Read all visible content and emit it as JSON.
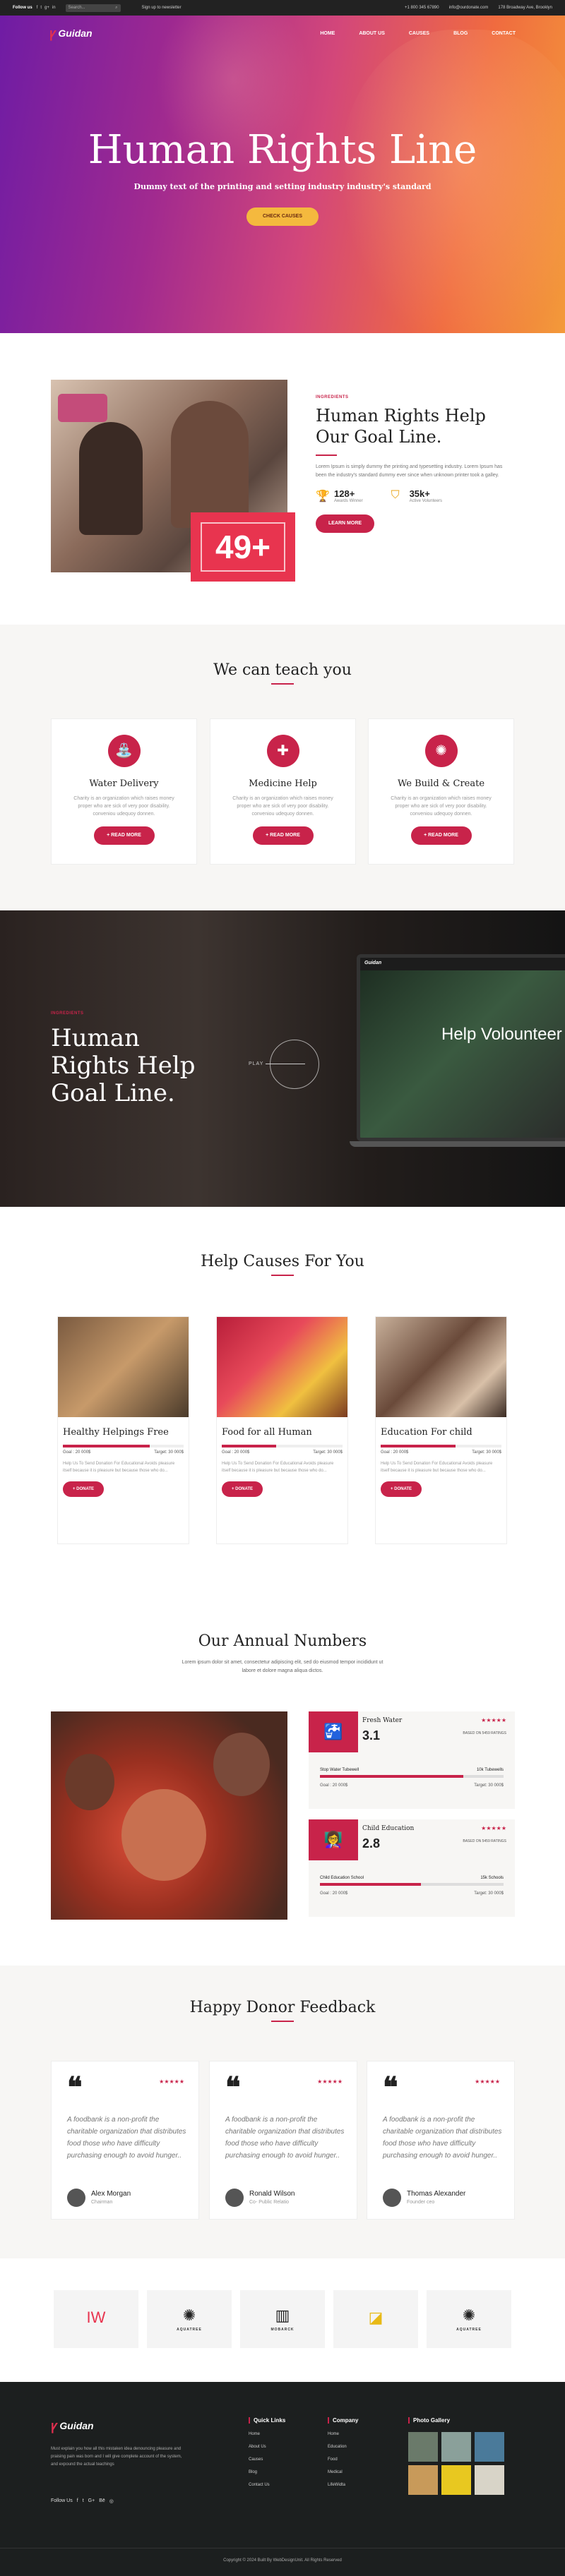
{
  "topbar": {
    "follow": "Follow us",
    "search_placeholder": "Search...",
    "signup": "Sign up to newsletter",
    "phone": "+1 800 345 67890",
    "email": "info@ourdonate.com",
    "address": "178 Broadway Ave, Brooklyn"
  },
  "nav": {
    "logo": "Guidan",
    "items": [
      "HOME",
      "ABOUT US",
      "CAUSES",
      "BLOG",
      "CONTACT"
    ]
  },
  "hero": {
    "title": "Human Rights Line",
    "subtitle": "Dummy text of the printing and setting industry industry's standard",
    "cta": "CHECK CAUSES"
  },
  "about": {
    "badge": "49+",
    "eyebrow": "INGREDIENTS",
    "title": "Human Rights Help Our Goal Line.",
    "text": "Lorem Ipsum is simply dummy the printing and typesetting industry. Lorem Ipsum has been the industry's standard dummy ever since when unknown printer took a galley.",
    "stats": [
      {
        "value": "128+",
        "label": "Awards Winner"
      },
      {
        "value": "35k+",
        "label": "Active Volunteers"
      }
    ],
    "button": "LEARN MORE"
  },
  "teach": {
    "title": "We can teach you",
    "cards": [
      {
        "title": "Water Delivery",
        "text": "Charity is an organization which raises money proper who are sick of very poor disability. conveniou udequoy donnen.",
        "button": "+ READ MORE"
      },
      {
        "title": "Medicine Help",
        "text": "Charity is an organization which raises money proper who are sick of very poor disability. conveniou udequoy donnen.",
        "button": "+ READ MORE"
      },
      {
        "title": "We Build & Create",
        "text": "Charity is an organization which raises money proper who are sick of very poor disability. conveniou udequoy donnen.",
        "button": "+ READ MORE"
      }
    ]
  },
  "band": {
    "eyebrow": "INGREDIENTS",
    "title": "Human Rights Help Goal Line.",
    "play": "PLAY",
    "screen_logo": "Guidan",
    "screen_title": "Help Volounteer"
  },
  "causes": {
    "title": "Help Causes For You",
    "items": [
      {
        "title": "Healthy Helpings Free",
        "progress": 0.72,
        "goal": "Goal : 20 000$",
        "target": "Target: 30 000$",
        "text": "Help Us To Send Donation For Educational Avoids pleasure itself because it is pleasure but because those who do...",
        "button": "+ DONATE"
      },
      {
        "title": "Food for all Human",
        "progress": 0.45,
        "goal": "Goal : 20 000$",
        "target": "Target: 30 000$",
        "text": "Help Us To Send Donation For Educational Avoids pleasure itself because it is pleasure but because those who do...",
        "button": "+ DONATE"
      },
      {
        "title": "Education For child",
        "progress": 0.62,
        "goal": "Goal : 20 000$",
        "target": "Target: 30 000$",
        "text": "Help Us To Send Donation For Educational Avoids pleasure itself because it is pleasure but because those who do...",
        "button": "+ DONATE"
      }
    ]
  },
  "numbers": {
    "title": "Our Annual Numbers",
    "text": "Lorem ipsum dolor sit amet, consectetur adipiscing elit, sed do eiusmod tempor incididunt ut labore et dolore magna aliqua dictos.",
    "cards": [
      {
        "name": "Fresh Water",
        "value": "3.1",
        "stars": "★★★★★",
        "basis": "BASED ON 5459 RATINGS",
        "row_label": "Stop Water Tubewell",
        "row_value": "10k Tubewells",
        "progress": 0.78,
        "goal": "Goal : 20 000$",
        "target": "Target: 30 000$"
      },
      {
        "name": "Child Education",
        "value": "2.8",
        "stars": "★★★★★",
        "basis": "BASED ON 5459 RATINGS",
        "row_label": "Child Education School",
        "row_value": "15k Schools",
        "progress": 0.55,
        "goal": "Goal : 20 000$",
        "target": "Target: 30 000$"
      }
    ]
  },
  "feedback": {
    "title": "Happy Donor Feedback",
    "items": [
      {
        "text": "A foodbank is a non-profit the charitable organization that distributes food those who have difficulty purchasing enough to avoid hunger..",
        "name": "Alex Morgan",
        "role": "Chairman",
        "stars": "★★★★★"
      },
      {
        "text": "A foodbank is a non-profit the charitable organization that distributes food those who have difficulty purchasing enough to avoid hunger..",
        "name": "Ronald Wilson",
        "role": "Co- Public Relatio",
        "stars": "★★★★★"
      },
      {
        "text": "A foodbank is a non-profit the charitable organization that distributes food those who have difficulty purchasing enough to avoid hunger..",
        "name": "Thomas Alexander",
        "role": "Founder ceo",
        "stars": "★★★★★"
      }
    ]
  },
  "sponsors": [
    {
      "glyph": "IW",
      "word": ""
    },
    {
      "glyph": "✺",
      "word": "AQUATREE"
    },
    {
      "glyph": "▥",
      "word": "MOBARCK"
    },
    {
      "glyph": "◪",
      "word": ""
    },
    {
      "glyph": "✺",
      "word": "AQUATREE"
    }
  ],
  "footer": {
    "logo": "Guidan",
    "about": "Must explain you how all this mistaken idea denouncing pleasure and praising pain was born and I will give complete account of the system, and expound the actual teachings",
    "follow": "Follow Us",
    "quick_title": "Quick Links",
    "quick": [
      "Home",
      "About Us",
      "Causes",
      "Blog",
      "Contact Us"
    ],
    "company_title": "Company",
    "company": [
      "Home",
      "Education",
      "Food",
      "Medical",
      "LifeWidta"
    ],
    "gallery_title": "Photo Gallery",
    "copyright": "Copyright © 2024 Built By WebDesignUnit. All Rights Reserved"
  },
  "colors": {
    "accent": "#c8234a",
    "cta": "#f4b93e"
  }
}
